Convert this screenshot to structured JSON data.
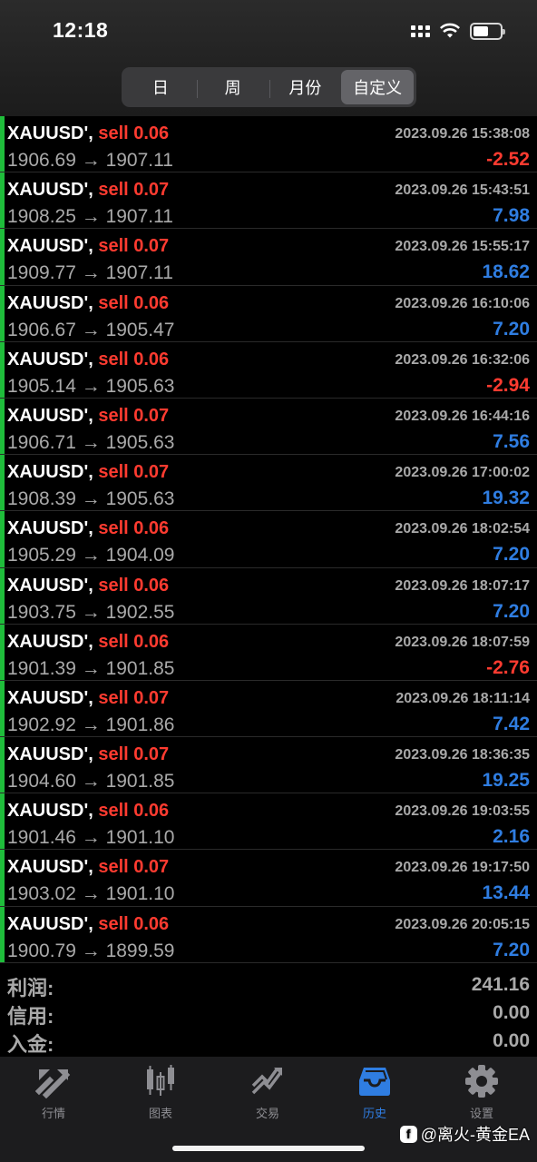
{
  "status_bar": {
    "time": "12:18"
  },
  "period_tabs": [
    {
      "label": "日",
      "active": false
    },
    {
      "label": "周",
      "active": false
    },
    {
      "label": "月份",
      "active": false
    },
    {
      "label": "自定义",
      "active": true
    }
  ],
  "trades": [
    {
      "symbol": "XAUUSD',",
      "side": "sell 0.06",
      "datetime": "2023.09.26 15:38:08",
      "prices": "1906.69 → 1907.11",
      "profit": "-2.52",
      "profit_sign": "neg"
    },
    {
      "symbol": "XAUUSD',",
      "side": "sell 0.07",
      "datetime": "2023.09.26 15:43:51",
      "prices": "1908.25 → 1907.11",
      "profit": "7.98",
      "profit_sign": "pos"
    },
    {
      "symbol": "XAUUSD',",
      "side": "sell 0.07",
      "datetime": "2023.09.26 15:55:17",
      "prices": "1909.77 → 1907.11",
      "profit": "18.62",
      "profit_sign": "pos"
    },
    {
      "symbol": "XAUUSD',",
      "side": "sell 0.06",
      "datetime": "2023.09.26 16:10:06",
      "prices": "1906.67 → 1905.47",
      "profit": "7.20",
      "profit_sign": "pos"
    },
    {
      "symbol": "XAUUSD',",
      "side": "sell 0.06",
      "datetime": "2023.09.26 16:32:06",
      "prices": "1905.14 → 1905.63",
      "profit": "-2.94",
      "profit_sign": "neg"
    },
    {
      "symbol": "XAUUSD',",
      "side": "sell 0.07",
      "datetime": "2023.09.26 16:44:16",
      "prices": "1906.71 → 1905.63",
      "profit": "7.56",
      "profit_sign": "pos"
    },
    {
      "symbol": "XAUUSD',",
      "side": "sell 0.07",
      "datetime": "2023.09.26 17:00:02",
      "prices": "1908.39 → 1905.63",
      "profit": "19.32",
      "profit_sign": "pos"
    },
    {
      "symbol": "XAUUSD',",
      "side": "sell 0.06",
      "datetime": "2023.09.26 18:02:54",
      "prices": "1905.29 → 1904.09",
      "profit": "7.20",
      "profit_sign": "pos"
    },
    {
      "symbol": "XAUUSD',",
      "side": "sell 0.06",
      "datetime": "2023.09.26 18:07:17",
      "prices": "1903.75 → 1902.55",
      "profit": "7.20",
      "profit_sign": "pos"
    },
    {
      "symbol": "XAUUSD',",
      "side": "sell 0.06",
      "datetime": "2023.09.26 18:07:59",
      "prices": "1901.39 → 1901.85",
      "profit": "-2.76",
      "profit_sign": "neg"
    },
    {
      "symbol": "XAUUSD',",
      "side": "sell 0.07",
      "datetime": "2023.09.26 18:11:14",
      "prices": "1902.92 → 1901.86",
      "profit": "7.42",
      "profit_sign": "pos"
    },
    {
      "symbol": "XAUUSD',",
      "side": "sell 0.07",
      "datetime": "2023.09.26 18:36:35",
      "prices": "1904.60 → 1901.85",
      "profit": "19.25",
      "profit_sign": "pos"
    },
    {
      "symbol": "XAUUSD',",
      "side": "sell 0.06",
      "datetime": "2023.09.26 19:03:55",
      "prices": "1901.46 → 1901.10",
      "profit": "2.16",
      "profit_sign": "pos"
    },
    {
      "symbol": "XAUUSD',",
      "side": "sell 0.07",
      "datetime": "2023.09.26 19:17:50",
      "prices": "1903.02 → 1901.10",
      "profit": "13.44",
      "profit_sign": "pos"
    },
    {
      "symbol": "XAUUSD',",
      "side": "sell 0.06",
      "datetime": "2023.09.26 20:05:15",
      "prices": "1900.79 → 1899.59",
      "profit": "7.20",
      "profit_sign": "pos"
    }
  ],
  "summary": [
    {
      "label": "利润:",
      "value": "241.16"
    },
    {
      "label": "信用:",
      "value": "0.00"
    },
    {
      "label": "入金:",
      "value": "0.00"
    }
  ],
  "tabbar": [
    {
      "label": "行情",
      "icon": "quotes-icon",
      "active": false
    },
    {
      "label": "图表",
      "icon": "chart-icon",
      "active": false
    },
    {
      "label": "交易",
      "icon": "trade-icon",
      "active": false
    },
    {
      "label": "历史",
      "icon": "history-icon",
      "active": true
    },
    {
      "label": "设置",
      "icon": "settings-icon",
      "active": false
    }
  ],
  "watermark": {
    "text": "@离火-黄金EA"
  },
  "colors": {
    "buy_bar": "#1fbd3b",
    "loss": "#ff3b30",
    "profit": "#2f7de1",
    "active_tab": "#2f7de1"
  }
}
